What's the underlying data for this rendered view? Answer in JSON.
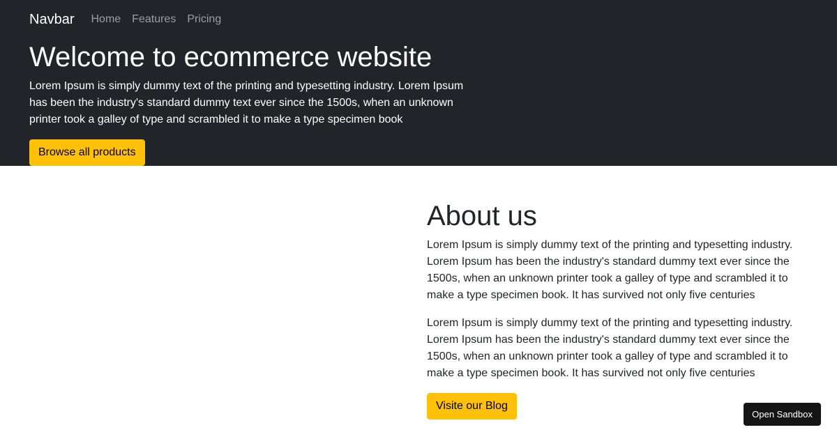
{
  "navbar": {
    "brand": "Navbar",
    "links": [
      "Home",
      "Features",
      "Pricing"
    ]
  },
  "hero": {
    "title": "Welcome to ecommerce website",
    "text": "Lorem Ipsum is simply dummy text of the printing and typesetting industry. Lorem Ipsum has been the industry's standard dummy text ever since the 1500s, when an unknown printer took a galley of type and scrambled it to make a type specimen book",
    "button_label": "Browse all products"
  },
  "about": {
    "title": "About us",
    "paragraphs": [
      "Lorem Ipsum is simply dummy text of the printing and typesetting industry. Lorem Ipsum has been the industry's standard dummy text ever since the 1500s, when an unknown printer took a galley of type and scrambled it to make a type specimen book. It has survived not only five centuries",
      "Lorem Ipsum is simply dummy text of the printing and typesetting industry. Lorem Ipsum has been the industry's standard dummy text ever since the 1500s, when an unknown printer took a galley of type and scrambled it to make a type specimen book. It has survived not only five centuries"
    ],
    "button_label": "Visite our Blog"
  },
  "sandbox": {
    "label": "Open Sandbox"
  },
  "colors": {
    "hero_background": "#212529",
    "accent": "#ffc107",
    "sandbox_button": "#151515"
  }
}
